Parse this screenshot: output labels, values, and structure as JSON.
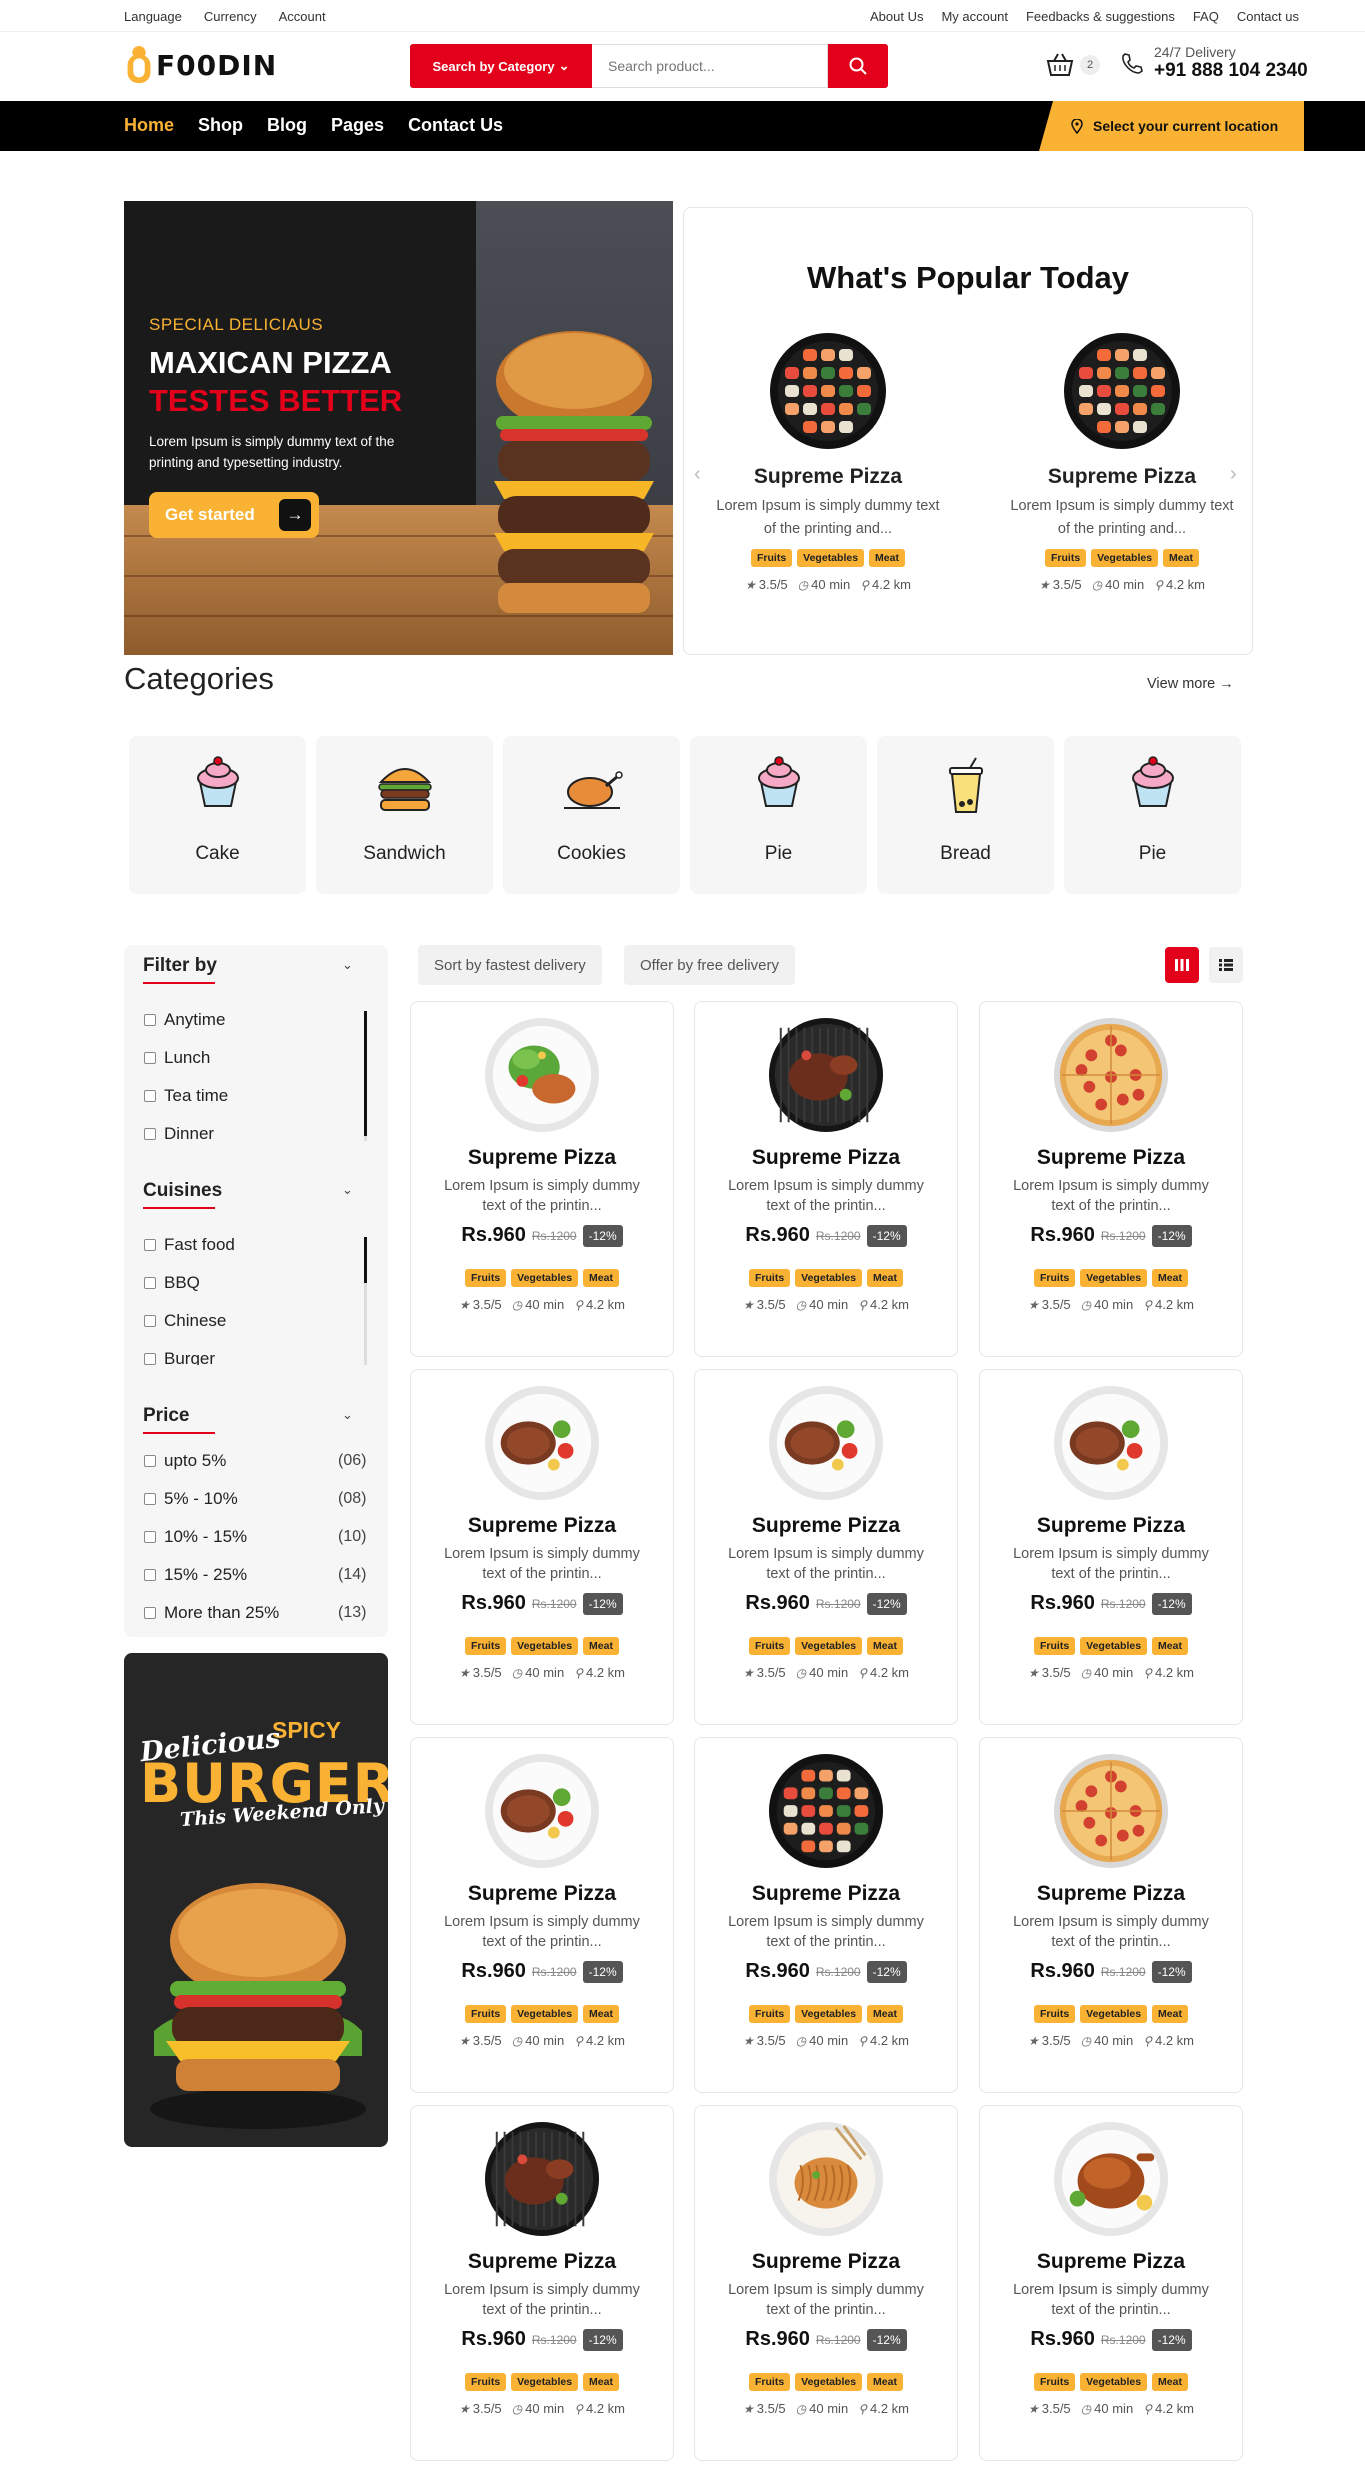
{
  "topbar": {
    "left": [
      "Language",
      "Currency",
      "Account"
    ],
    "right": [
      "About Us",
      "My account",
      "Feedbacks & suggestions",
      "FAQ",
      "Contact us"
    ]
  },
  "header": {
    "logo_text": "F00DIN",
    "category_button": "Search by Category",
    "search_placeholder": "Search product...",
    "cart_count": "2",
    "delivery_label": "24/7 Delivery",
    "phone": "+91 888 104 2340"
  },
  "nav": {
    "items": [
      "Home",
      "Shop",
      "Blog",
      "Pages",
      "Contact Us"
    ],
    "active": "Home",
    "location_label": "Select your current location"
  },
  "hero": {
    "eyebrow": "SPECIAL DELICIAUS",
    "title": "MAXICAN PIZZA",
    "subtitle": "TESTES BETTER",
    "text": "Lorem Ipsum is simply dummy text of the printing and typesetting industry.",
    "button": "Get started"
  },
  "popular": {
    "title": "What's Popular Today",
    "items": [
      {
        "name": "Supreme Pizza",
        "desc": "Lorem Ipsum is simply dummy text of the printing and...",
        "tags": [
          "Fruits",
          "Vegetables",
          "Meat"
        ],
        "rating": "3.5/5",
        "time": "40 min",
        "distance": "4.2 km",
        "image": "sushi-platter"
      },
      {
        "name": "Supreme Pizza",
        "desc": "Lorem Ipsum is simply dummy text of the printing and...",
        "tags": [
          "Fruits",
          "Vegetables",
          "Meat"
        ],
        "rating": "3.5/5",
        "time": "40 min",
        "distance": "4.2 km",
        "image": "sushi-platter"
      }
    ]
  },
  "categories": {
    "title": "Categories",
    "view_more": "View more",
    "items": [
      {
        "label": "Cake",
        "icon": "cupcake-icon"
      },
      {
        "label": "Sandwich",
        "icon": "burger-icon"
      },
      {
        "label": "Cookies",
        "icon": "roast-chicken-icon"
      },
      {
        "label": "Pie",
        "icon": "cupcake-icon"
      },
      {
        "label": "Bread",
        "icon": "bubble-tea-icon"
      },
      {
        "label": "Pie",
        "icon": "cupcake-icon"
      }
    ]
  },
  "filters": {
    "filter_by": {
      "title": "Filter by",
      "options": [
        "Anytime",
        "Lunch",
        "Tea time",
        "Dinner"
      ]
    },
    "cuisines": {
      "title": "Cuisines",
      "options": [
        "Fast food",
        "BBQ",
        "Chinese",
        "Burger"
      ]
    },
    "price": {
      "title": "Price",
      "options": [
        {
          "label": "upto 5%",
          "count": "(06)"
        },
        {
          "label": "5% - 10%",
          "count": "(08)"
        },
        {
          "label": "10% - 15%",
          "count": "(10)"
        },
        {
          "label": "15% - 25%",
          "count": "(14)"
        },
        {
          "label": "More than 25%",
          "count": "(13)"
        }
      ]
    }
  },
  "promo": {
    "spicy": "SPICY",
    "delicious": "Delicious",
    "burger": "BURGER",
    "weekend": "This Weekend Only"
  },
  "toolbar": {
    "sort_fastest": "Sort by fastest delivery",
    "offer_free": "Offer by free delivery"
  },
  "products": [
    {
      "name": "Supreme Pizza",
      "desc": "Lorem Ipsum is simply dummy text of the printin...",
      "price": "Rs.960",
      "old_price": "Rs.1200",
      "discount": "-12%",
      "tags": [
        "Fruits",
        "Vegetables",
        "Meat"
      ],
      "rating": "3.5/5",
      "time": "40 min",
      "distance": "4.2 km",
      "image": "salad-plate"
    },
    {
      "name": "Supreme Pizza",
      "desc": "Lorem Ipsum is simply dummy text of the printin...",
      "price": "Rs.960",
      "old_price": "Rs.1200",
      "discount": "-12%",
      "tags": [
        "Fruits",
        "Vegetables",
        "Meat"
      ],
      "rating": "3.5/5",
      "time": "40 min",
      "distance": "4.2 km",
      "image": "grill-plate"
    },
    {
      "name": "Supreme Pizza",
      "desc": "Lorem Ipsum is simply dummy text of the printin...",
      "price": "Rs.960",
      "old_price": "Rs.1200",
      "discount": "-12%",
      "tags": [
        "Fruits",
        "Vegetables",
        "Meat"
      ],
      "rating": "3.5/5",
      "time": "40 min",
      "distance": "4.2 km",
      "image": "pizza"
    },
    {
      "name": "Supreme Pizza",
      "desc": "Lorem Ipsum is simply dummy text of the printin...",
      "price": "Rs.960",
      "old_price": "Rs.1200",
      "discount": "-12%",
      "tags": [
        "Fruits",
        "Vegetables",
        "Meat"
      ],
      "rating": "3.5/5",
      "time": "40 min",
      "distance": "4.2 km",
      "image": "steak-plate"
    },
    {
      "name": "Supreme Pizza",
      "desc": "Lorem Ipsum is simply dummy text of the printin...",
      "price": "Rs.960",
      "old_price": "Rs.1200",
      "discount": "-12%",
      "tags": [
        "Fruits",
        "Vegetables",
        "Meat"
      ],
      "rating": "3.5/5",
      "time": "40 min",
      "distance": "4.2 km",
      "image": "steak-plate"
    },
    {
      "name": "Supreme Pizza",
      "desc": "Lorem Ipsum is simply dummy text of the printin...",
      "price": "Rs.960",
      "old_price": "Rs.1200",
      "discount": "-12%",
      "tags": [
        "Fruits",
        "Vegetables",
        "Meat"
      ],
      "rating": "3.5/5",
      "time": "40 min",
      "distance": "4.2 km",
      "image": "steak-plate"
    },
    {
      "name": "Supreme Pizza",
      "desc": "Lorem Ipsum is simply dummy text of the printin...",
      "price": "Rs.960",
      "old_price": "Rs.1200",
      "discount": "-12%",
      "tags": [
        "Fruits",
        "Vegetables",
        "Meat"
      ],
      "rating": "3.5/5",
      "time": "40 min",
      "distance": "4.2 km",
      "image": "steak-plate"
    },
    {
      "name": "Supreme Pizza",
      "desc": "Lorem Ipsum is simply dummy text of the printin...",
      "price": "Rs.960",
      "old_price": "Rs.1200",
      "discount": "-12%",
      "tags": [
        "Fruits",
        "Vegetables",
        "Meat"
      ],
      "rating": "3.5/5",
      "time": "40 min",
      "distance": "4.2 km",
      "image": "sushi-platter"
    },
    {
      "name": "Supreme Pizza",
      "desc": "Lorem Ipsum is simply dummy text of the printin...",
      "price": "Rs.960",
      "old_price": "Rs.1200",
      "discount": "-12%",
      "tags": [
        "Fruits",
        "Vegetables",
        "Meat"
      ],
      "rating": "3.5/5",
      "time": "40 min",
      "distance": "4.2 km",
      "image": "pizza"
    },
    {
      "name": "Supreme Pizza",
      "desc": "Lorem Ipsum is simply dummy text of the printin...",
      "price": "Rs.960",
      "old_price": "Rs.1200",
      "discount": "-12%",
      "tags": [
        "Fruits",
        "Vegetables",
        "Meat"
      ],
      "rating": "3.5/5",
      "time": "40 min",
      "distance": "4.2 km",
      "image": "grill-plate"
    },
    {
      "name": "Supreme Pizza",
      "desc": "Lorem Ipsum is simply dummy text of the printin...",
      "price": "Rs.960",
      "old_price": "Rs.1200",
      "discount": "-12%",
      "tags": [
        "Fruits",
        "Vegetables",
        "Meat"
      ],
      "rating": "3.5/5",
      "time": "40 min",
      "distance": "4.2 km",
      "image": "noodles-plate"
    },
    {
      "name": "Supreme Pizza",
      "desc": "Lorem Ipsum is simply dummy text of the printin...",
      "price": "Rs.960",
      "old_price": "Rs.1200",
      "discount": "-12%",
      "tags": [
        "Fruits",
        "Vegetables",
        "Meat"
      ],
      "rating": "3.5/5",
      "time": "40 min",
      "distance": "4.2 km",
      "image": "roast-chicken-plate"
    }
  ],
  "colors": {
    "accent_red": "#e2001a",
    "accent_yellow": "#f9b233",
    "nav_bg": "#000000"
  }
}
